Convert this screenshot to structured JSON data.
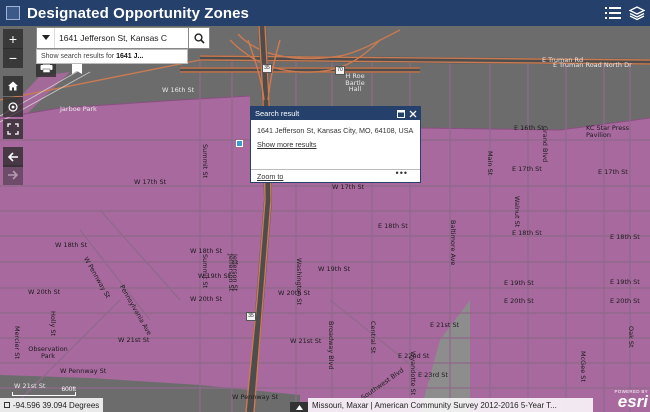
{
  "header": {
    "title": "Designated Opportunity Zones",
    "menu_icon": "list-icon",
    "layers_icon": "layers-icon"
  },
  "toolbar": {
    "zoom_in": "+",
    "zoom_out": "−",
    "home_icon": "home-icon",
    "locate_icon": "locate-icon",
    "fullscreen_icon": "fullscreen-icon",
    "back_icon": "arrow-left-icon",
    "forward_icon": "arrow-right-icon",
    "print_icon": "printer-icon"
  },
  "search": {
    "value": "1641 Jefferson St, Kansas C",
    "clear": "✕",
    "suggest_prefix": "Show search results for ",
    "suggest_term": "1641 J..."
  },
  "popup": {
    "title": "Search result",
    "address": "1641 Jefferson St, Kansas City, MO, 64108, USA",
    "more_link": "Show more results",
    "zoom_link": "Zoom to",
    "actions": "•••"
  },
  "map_labels": {
    "e_truman": "E Truman Rd",
    "truman_north": "E Truman Road North Dr",
    "west_16th": "W 16th St",
    "west_17th": "W 17th St",
    "west_17th_b": "W 17th St",
    "west_18th_a": "W 18th St",
    "west_18th_b": "W 18th St",
    "west_19th": "W 19th St",
    "west_19th_b": "W 19th St",
    "west_20th": "W 20th St",
    "west_20th_b": "W 20th St",
    "west_20th_c": "W 20th St",
    "west_21st": "W 21st St",
    "west_21st_b": "W 21st St",
    "west_pennway": "W Pennway St",
    "west_pennway_b": "W Pennway St",
    "w_pennway_st_low": "W Pennway St",
    "e_16th": "E 16th St",
    "e_17th": "E 17th St",
    "e_17th_b": "E 17th St",
    "e_18th": "E 18th St",
    "e_18th_b": "E 18th St",
    "e_18th_c": "E 18th St",
    "e_19th": "E 19th St",
    "e_19th_b": "E 19th St",
    "e_20th": "E 20th St",
    "e_20th_b": "E 20th St",
    "e_21st": "E 21st St",
    "e_22nd": "E 22nd St",
    "e_23rd": "E 23rd St",
    "w_16th_b": "W 16th St",
    "jarboe_park": "Jarboe Park",
    "observation_park": "Observation Park",
    "kc_star_press": "KC Star Press Pavilion",
    "h_roe_bartle": "H Roe Bartle Hall",
    "summit": "Summit St",
    "summit_b": "Summit St",
    "jefferson": "Jefferson St",
    "jefferson_b": "Jefferson St",
    "washington": "Washington St",
    "broadway": "Broadway Blvd",
    "central": "Central St",
    "wyandotte": "Wyandotte St",
    "baltimore": "Baltimore Ave",
    "southwest": "Southwest Blvd",
    "grand": "Grand Blvd",
    "walnut": "Walnut St",
    "main": "Main St",
    "mcgee": "McGee St",
    "oak": "Oak St",
    "holly": "Holly St",
    "mercier": "Mercier St",
    "w_pennway_diag": "W Pennway St",
    "pennsylvania": "Pennsylvania Ave",
    "w_jarboe": "W Jarboe St",
    "w_20th_d": "W 20th St"
  },
  "shields": [
    "35",
    "70",
    "35"
  ],
  "status": {
    "coords": "-94.596 39.094 Degrees",
    "scale_label": "600ft",
    "attribution": "Missouri, Maxar | American Community Survey 2012-2016 5-Year T...",
    "esri_powered": "POWERED BY",
    "esri_name": "esri"
  },
  "colors": {
    "header": "#24406b",
    "zone_fill": "#a8699f",
    "base_gray": "#6e6e6e",
    "road_orange": "#d07a4a"
  }
}
